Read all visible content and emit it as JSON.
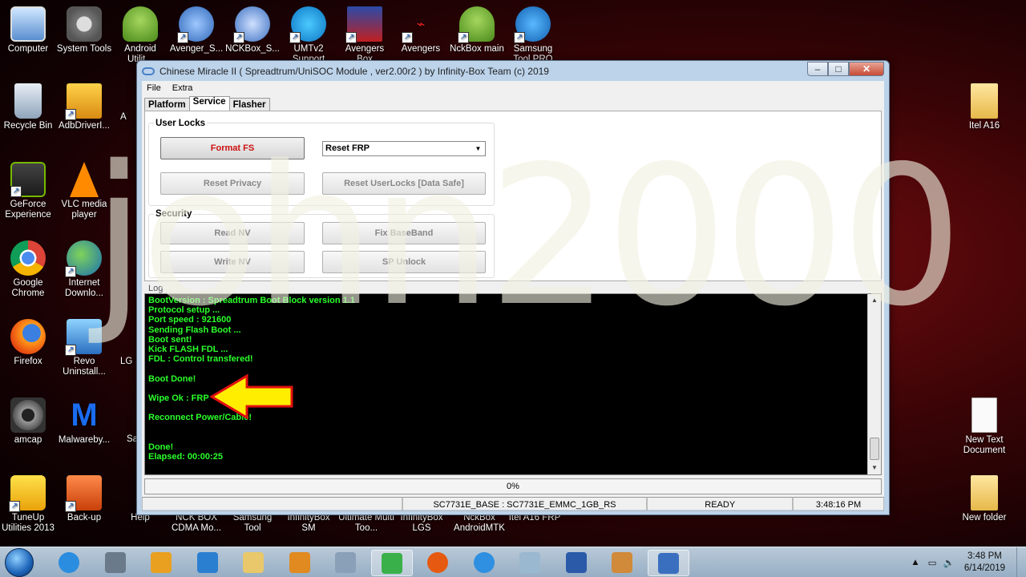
{
  "desktop": {
    "icons": [
      {
        "label": "Computer"
      },
      {
        "label": "System Tools"
      },
      {
        "label": "Android Utilit..."
      },
      {
        "label": "Avenger_S..."
      },
      {
        "label": "NCKBox_S..."
      },
      {
        "label": "UMTv2 Support"
      },
      {
        "label": "Avengers Box"
      },
      {
        "label": "Avengers"
      },
      {
        "label": "NckBox main"
      },
      {
        "label": "Samsung Tool PRO"
      },
      {
        "label": "Recycle Bin"
      },
      {
        "label": "AdbDriverI..."
      },
      {
        "label": "GeForce Experience"
      },
      {
        "label": "VLC media player"
      },
      {
        "label": "Google Chrome"
      },
      {
        "label": "Internet Downlo..."
      },
      {
        "label": "Firefox"
      },
      {
        "label": "Revo Uninstall..."
      },
      {
        "label": "amcap"
      },
      {
        "label": "Malwareby..."
      },
      {
        "label": "TuneUp Utilities 2013"
      },
      {
        "label": "Back-up"
      },
      {
        "label": "Help"
      },
      {
        "label": "NCK BOX CDMA Mo..."
      },
      {
        "label": "Samsung Tool"
      },
      {
        "label": "InfinityBox SM"
      },
      {
        "label": "Ultimate Multi Too..."
      },
      {
        "label": "InfinityBox LGS"
      },
      {
        "label": "NckBox AndroidMTK"
      },
      {
        "label": "Itel A16 FRP"
      },
      {
        "label": "Itel A16"
      },
      {
        "label": "New Text Document"
      },
      {
        "label": "New folder"
      },
      {
        "label": "A"
      },
      {
        "label": "LG"
      },
      {
        "label": "Sa"
      }
    ]
  },
  "window": {
    "title": "Chinese Miracle II ( Spreadtrum/UniSOC Module , ver2.00r2  ) by Infinity-Box Team (c) 2019",
    "controls": {
      "minimize": "–",
      "maximize": "□",
      "close": "✕"
    },
    "menu": [
      "File",
      "Extra"
    ],
    "tabs": [
      {
        "label": "Platform",
        "active": false
      },
      {
        "label": "Service",
        "active": true
      },
      {
        "label": "Flasher",
        "active": false
      }
    ],
    "user_locks": {
      "title": "User Locks",
      "format_fs": "Format FS",
      "reset_frp_select": "Reset FRP",
      "reset_privacy": "Reset Privacy",
      "reset_userlocks": "Reset UserLocks [Data Safe]"
    },
    "security": {
      "title": "Security",
      "read_nv": "Read NV",
      "fix_baseband": "Fix BaseBand",
      "write_nv": "Write NV",
      "sp_unlock": "SP Unlock"
    },
    "log_label": "Log",
    "log_lines": [
      "BootVersion : Spreadtrum Boot Block version 1.1",
      "Protocol setup ...",
      "Port speed : 921600",
      "Sending Flash Boot ...",
      "Boot sent!",
      "Kick FLASH FDL ...",
      "FDL : Control transfered!",
      "",
      "Boot Done!",
      "",
      "Wipe Ok : FRP",
      "",
      "Reconnect Power/Cable!",
      "",
      "",
      "Done!",
      "Elapsed: 00:00:25"
    ],
    "progress_text": "0%",
    "progress_value": 0,
    "status": {
      "device": "SC7731E_BASE : SC7731E_EMMC_1GB_RS",
      "state": "READY",
      "time": "3:48:16 PM"
    }
  },
  "watermark": "john2000",
  "taskbar": {
    "pinned": [
      "ie-icon",
      "app-icon",
      "infinity-icon",
      "store-icon",
      "explorer-icon",
      "media-icon",
      "calculator-icon",
      "app2-icon",
      "firefox-icon",
      "chrome-icon",
      "glass-icon",
      "word-icon",
      "paint-icon",
      "spd-icon"
    ],
    "clock_time": "3:48 PM",
    "clock_date": "6/14/2019"
  },
  "colors": {
    "log_text": "#2aff2a",
    "format_fs_text": "#cc1010",
    "arrow_fill": "#ffee00",
    "arrow_stroke": "#e01010"
  }
}
